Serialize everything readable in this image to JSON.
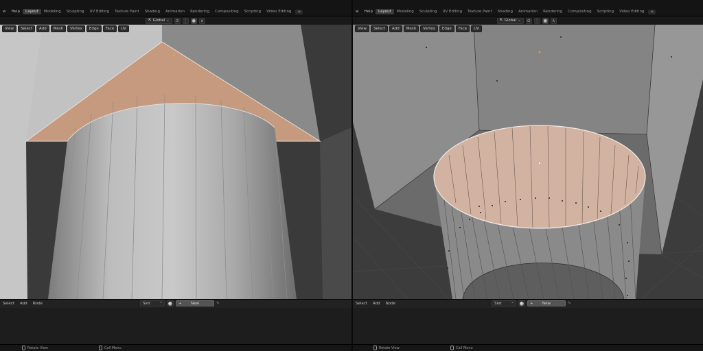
{
  "menu": [
    "w",
    "Help"
  ],
  "workspace_tabs": [
    "Layout",
    "Modeling",
    "Sculpting",
    "UV Editing",
    "Texture Paint",
    "Shading",
    "Animation",
    "Rendering",
    "Compositing",
    "Scripting",
    "Video Editing"
  ],
  "active_workspace": "Layout",
  "workspace_add": "+",
  "transform": {
    "orientation": "Global"
  },
  "viewport_menu": [
    "View",
    "Select",
    "Add",
    "Mesh",
    "Vertex",
    "Edge",
    "Face",
    "UV"
  ],
  "node_editor": {
    "menu": [
      "Select",
      "Add",
      "Node"
    ],
    "slot_label": "Slot",
    "new_label": "New",
    "new_plus": "+"
  },
  "status": {
    "rotate_view": "Rotate View",
    "call_menu": "Call Menu"
  },
  "colors": {
    "selected_face": "#c59a7f",
    "mesh_light": "#b9b9b9",
    "mesh_mid": "#9d9d9d",
    "grid_bg": "#3c3c3c"
  }
}
